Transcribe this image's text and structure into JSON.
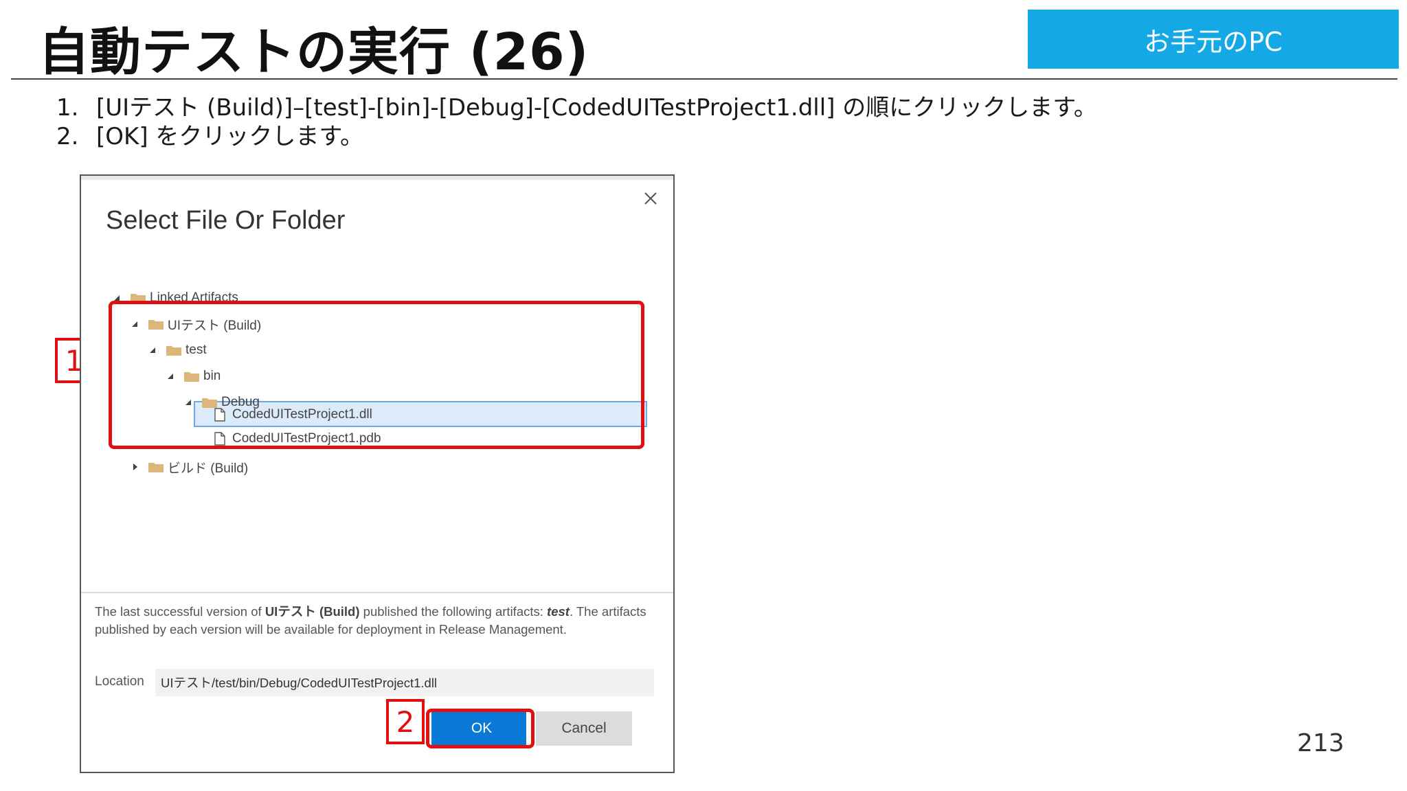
{
  "slide": {
    "title": "自動テストの実行 (26)",
    "env_badge": "お手元のPC",
    "page_number": "213",
    "steps": [
      {
        "num": "1.",
        "text": "[UIテスト (Build)]–[test]-[bin]-[Debug]-[CodedUITestProject1.dll] の順にクリックします。"
      },
      {
        "num": "2.",
        "text": "[OK] をクリックします。"
      }
    ]
  },
  "dialog": {
    "title": "Select File Or Folder",
    "tree": [
      {
        "label": "Linked Artifacts",
        "type": "folder",
        "expanded": true
      },
      {
        "label": "UIテスト (Build)",
        "type": "folder",
        "expanded": true
      },
      {
        "label": "test",
        "type": "folder",
        "expanded": true
      },
      {
        "label": "bin",
        "type": "folder",
        "expanded": true
      },
      {
        "label": "Debug",
        "type": "folder",
        "expanded": true
      },
      {
        "label": "CodedUITestProject1.dll",
        "type": "file",
        "selected": true
      },
      {
        "label": "CodedUITestProject1.pdb",
        "type": "file"
      },
      {
        "label": "ビルド (Build)",
        "type": "folder",
        "expanded": false
      }
    ],
    "info": {
      "p1": "The last successful version of ",
      "b1": "UIテスト (Build)",
      "p2": " published the following artifacts: ",
      "b2": "test",
      "p3": ". The artifacts published by each version will be available for deployment in Release Management."
    },
    "location_label": "Location",
    "location_value": "UIテスト/test/bin/Debug/CodedUITestProject1.dll",
    "ok_label": "OK",
    "cancel_label": "Cancel"
  },
  "callouts": {
    "one": "1",
    "two": "2"
  },
  "colors": {
    "accent_blue": "#14a8e6",
    "ok_blue": "#0a78d7",
    "callout_red": "#e01010",
    "folder": "#dcb67a"
  }
}
